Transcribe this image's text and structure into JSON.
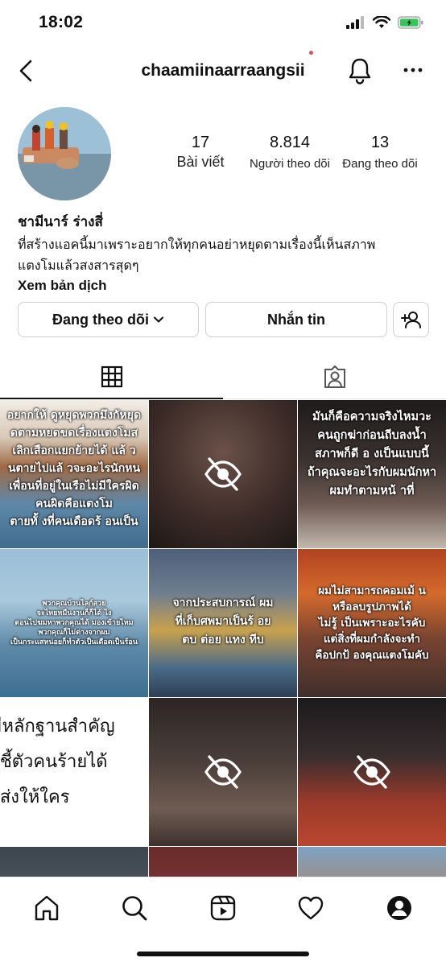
{
  "status_bar": {
    "time": "18:02"
  },
  "nav": {
    "username": "chaamiinaarraangsii"
  },
  "stats": [
    {
      "count": "17",
      "label": "Bài viết"
    },
    {
      "count": "8.814",
      "label": "Người theo dõi"
    },
    {
      "count": "13",
      "label": "Đang theo dõi"
    }
  ],
  "bio": {
    "name": "ชามีนาร์ ร่างสี่",
    "line1": "ที่สร้างแอคนี้มาเพราะอยากให้ทุกคนอย่าหยุดตามเรื่องนี้เห็นสภาพ",
    "line2": "แตงโมแล้วสงสารสุดๆ",
    "translate": "Xem bản dịch"
  },
  "actions": {
    "following": "Đang theo dõi",
    "message": "Nhắn tin"
  },
  "posts": {
    "p1": [
      "อยากให้ ดูหยุดพวกมึงกัหยุด",
      "ดตามหยดขดเรื่องแตงโมส",
      "เลิกเสือกแยกย้ายได้ แล้ ว",
      "นตายไปแล้ วจะอะไรนักหน",
      "เพื่อนที่อยู่ในเรือไม่มีใครผิด",
      "คนผิดคือแตงโม",
      "ตายทั้ งที่คนเดือดร้ อนเป็น"
    ],
    "p3": [
      "มันก็คือความจริงไหมวะ",
      "คนถูกฆ่าก่อนถีบลงน้ำ",
      "สภาพก็ดี อ งเป็นแบบนี้",
      "ถ้าคุณจะอะไรกับผมนักหา",
      "ผมทำตามหน้ าที่"
    ],
    "p4": [
      "พวกคุณบ้านไลก์สวย",
      "จะไทยหมืนงานก็ก็ได้ ไง",
      "ตอนไปฆมหาพวกคุณได้ มองเข้ายไหม",
      "พวกคุณก็ไม่ต่างจากผม",
      "เป็นกระแสหน่อยก็ทำตัวเป็นเดือดเป็นร้อน"
    ],
    "p5": [
      "จากประสบการณ์ ผม",
      "ที่เก็บศพมาเป็นร้ อย",
      "ตบ ต่อย แทง ทีบ"
    ],
    "p6": [
      "ผมไม่สามารถคอมเม้ น",
      "หรือลบรูปภาพได้",
      "ไม่รู้ เป็นเพราะอะไรคับ",
      "แต่สิ่งที่ผมกำลังจะทำ",
      "คือปกป้ องคุณแตงโมคับ"
    ],
    "p7": [
      "มีหลักฐานสำคัญ",
      "ะชี้ตัวคนร้ายได้",
      "รส่งให้ใคร"
    ]
  },
  "colors": {
    "accent_dot": "#ed4956",
    "battery": "#34c759"
  },
  "icons": [
    "back-arrow-icon",
    "bell-icon",
    "more-icon",
    "grid-icon",
    "tagged-icon",
    "hidden-eye-icon",
    "home-icon",
    "search-icon",
    "reels-icon",
    "heart-icon",
    "profile-icon",
    "add-user-icon",
    "chevron-down-icon"
  ]
}
